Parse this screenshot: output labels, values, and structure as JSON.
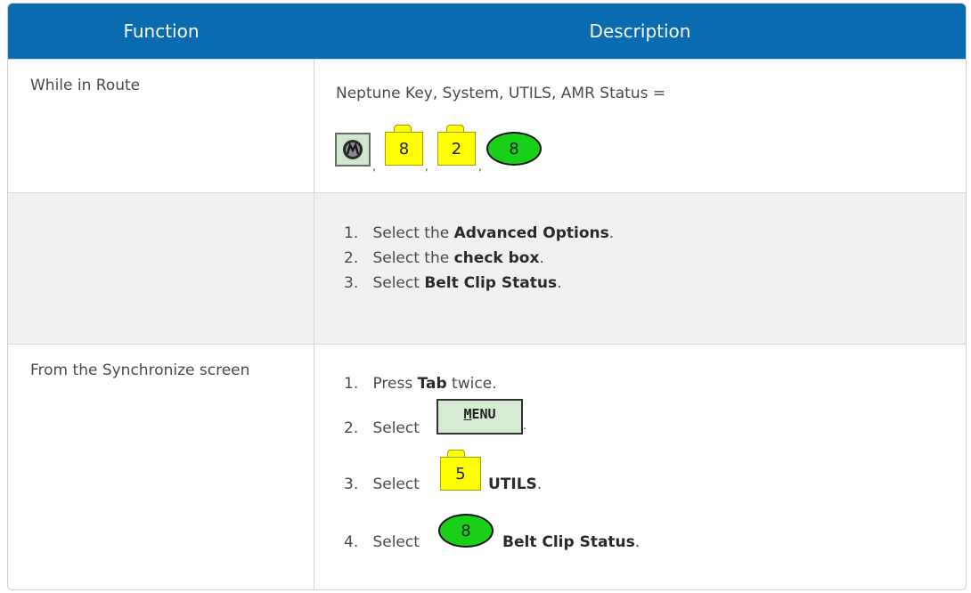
{
  "header": {
    "function": "Function",
    "description": "Description"
  },
  "row1": {
    "function": "While in Route",
    "description": "Neptune Key, System, UTILS, AMR Status =",
    "keys": {
      "system": "8",
      "utils": "2",
      "amr": "8"
    },
    "separator": ","
  },
  "row2": {
    "steps": [
      {
        "num": "1.",
        "pre": "Select the ",
        "bold": "Advanced Options",
        "post": "."
      },
      {
        "num": "2.",
        "pre": "Select the ",
        "bold": "check box",
        "post": "."
      },
      {
        "num": "3.",
        "pre": "Select ",
        "bold": "Belt Clip Status",
        "post": "."
      }
    ]
  },
  "row3": {
    "function": "From the Synchronize screen",
    "steps": [
      {
        "num": "1.",
        "pre": "Press ",
        "bold": "Tab",
        "post": " twice."
      },
      {
        "num": "2.",
        "pre": "Select ",
        "key": "MENU",
        "post": "."
      },
      {
        "num": "3.",
        "pre": "Select ",
        "key": "5",
        "bold": "UTILS",
        "post": "."
      },
      {
        "num": "4.",
        "pre": "Select ",
        "key": "8",
        "bold": "Belt Clip Status",
        "post": "."
      }
    ]
  },
  "colors": {
    "header_bg": "#0a6bb0",
    "yellow_key": "#ffff00",
    "green_key": "#17d017",
    "menu_key": "#d6ecd2",
    "shaded_row": "#f0f0f0"
  }
}
